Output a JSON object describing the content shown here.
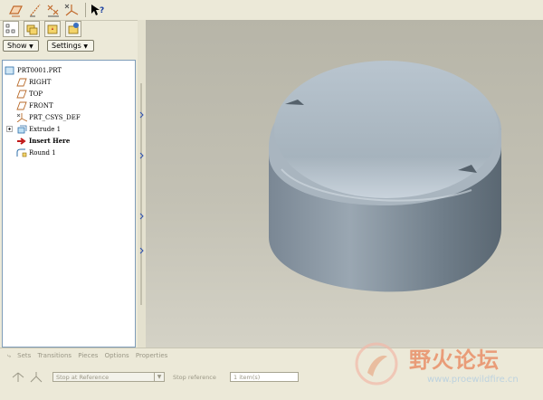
{
  "toolbar": {
    "icons": [
      "datum-plane-display-icon",
      "datum-axis-display-icon",
      "datum-point-display-icon",
      "coordinate-system-display-icon",
      "whats-this-help-icon"
    ]
  },
  "navigator": {
    "tabs": [
      "model-tree-icon",
      "folder-browser-icon",
      "favorites-icon",
      "web-connection-icon"
    ],
    "show_label": "Show",
    "settings_label": "Settings",
    "tree": [
      {
        "label": "PRT0001.PRT",
        "icon": "part-icon"
      },
      {
        "label": "RIGHT",
        "icon": "datum-plane-icon"
      },
      {
        "label": "TOP",
        "icon": "datum-plane-icon"
      },
      {
        "label": "FRONT",
        "icon": "datum-plane-icon"
      },
      {
        "label": "PRT_CSYS_DEF",
        "icon": "csys-icon"
      },
      {
        "label": "Extrude 1",
        "icon": "extrude-icon"
      },
      {
        "label": "Insert Here",
        "icon": "insert-arrow-icon"
      },
      {
        "label": "Round 1",
        "icon": "round-icon"
      }
    ]
  },
  "dashboard": {
    "tabs": [
      "Sets",
      "Transitions",
      "Pieces",
      "Options",
      "Properties"
    ],
    "stop_at": "Stop at Reference",
    "stop_reference_label": "Stop reference",
    "stop_reference_value": "1 item(s)"
  },
  "watermark": {
    "title": "野火论坛",
    "url": "www.proewildfire.cn"
  }
}
